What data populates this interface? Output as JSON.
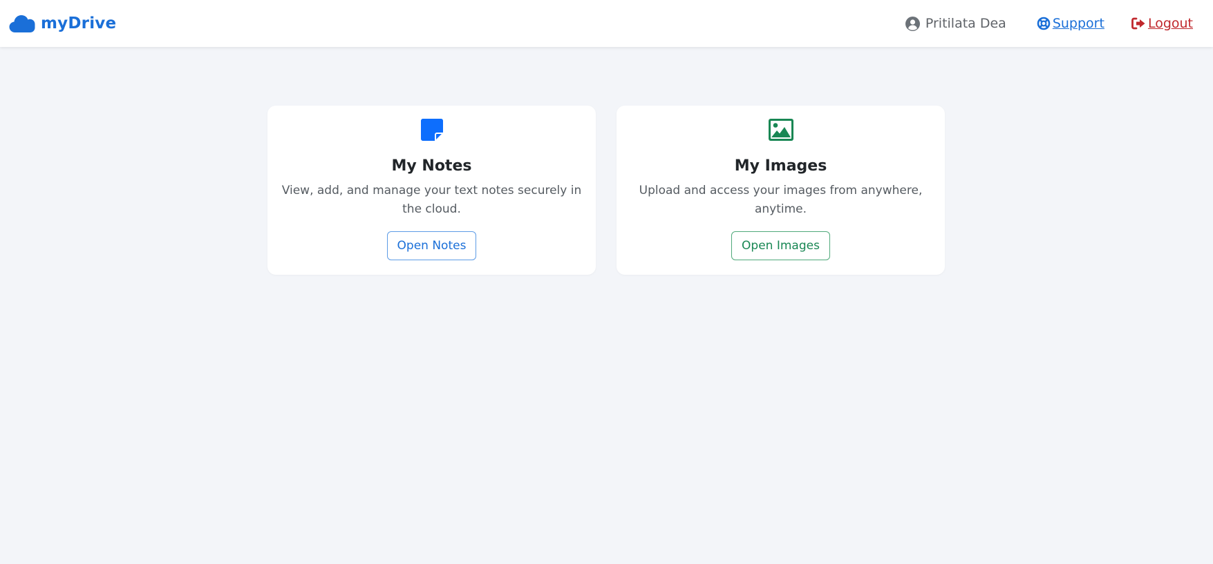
{
  "app": {
    "brand": "myDrive",
    "brand_color": "#1a6fd8"
  },
  "nav": {
    "user_name": "Pritilata Dea",
    "support_label": "Support",
    "logout_label": "Logout",
    "support_color": "#1a6fd8",
    "logout_color": "#c0282d",
    "icons": {
      "brand": "cloud-icon",
      "user": "user-circle-icon",
      "support": "life-ring-icon",
      "logout": "sign-out-icon"
    }
  },
  "cards": [
    {
      "title": "My Notes",
      "description": "View, add, and manage your text notes securely in the cloud.",
      "button_label": "Open Notes",
      "icon": "sticky-note-icon",
      "accent": "#0d6efd"
    },
    {
      "title": "My Images",
      "description": "Upload and access your images from anywhere, anytime.",
      "button_label": "Open Images",
      "icon": "image-icon",
      "accent": "#198754"
    }
  ]
}
